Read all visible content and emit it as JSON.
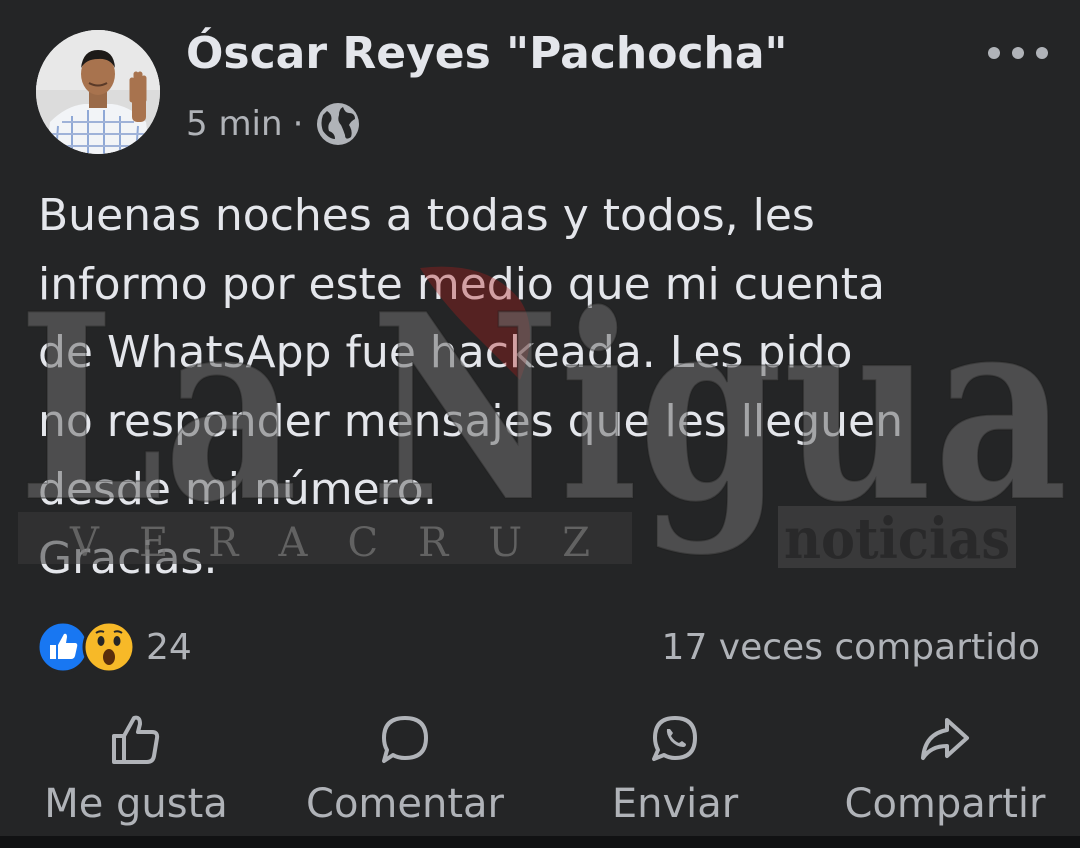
{
  "post": {
    "author": "Óscar Reyes \"Pachocha\"",
    "time": "5 min",
    "separator": "·",
    "privacy_icon": "globe-icon",
    "menu_icon": "more-dots-icon",
    "body": "Buenas noches a todas y todos, les\ninformo por este medio que mi cuenta\nde WhatsApp fue hackeada. Les pido\nno responder mensajes que les lleguen\ndesde mi número.\nGracias."
  },
  "watermark": {
    "brand": "La Nigua",
    "region": "V E R A C R U Z",
    "tag": "noticias"
  },
  "engagement": {
    "reaction_icons": [
      "like-reaction-icon",
      "wow-reaction-icon"
    ],
    "reaction_count": "24",
    "shares_text": "17 veces compartido"
  },
  "actions": {
    "like": {
      "label": "Me gusta",
      "icon": "thumbs-up-icon"
    },
    "comment": {
      "label": "Comentar",
      "icon": "comment-bubble-icon"
    },
    "send": {
      "label": "Enviar",
      "icon": "whatsapp-icon"
    },
    "share": {
      "label": "Compartir",
      "icon": "share-arrow-icon"
    }
  },
  "colors": {
    "background": "#242526",
    "primary_text": "#e4e6eb",
    "secondary_text": "#b0b3b8",
    "like_blue": "#1877f2",
    "wow_yellow": "#f7b928"
  }
}
